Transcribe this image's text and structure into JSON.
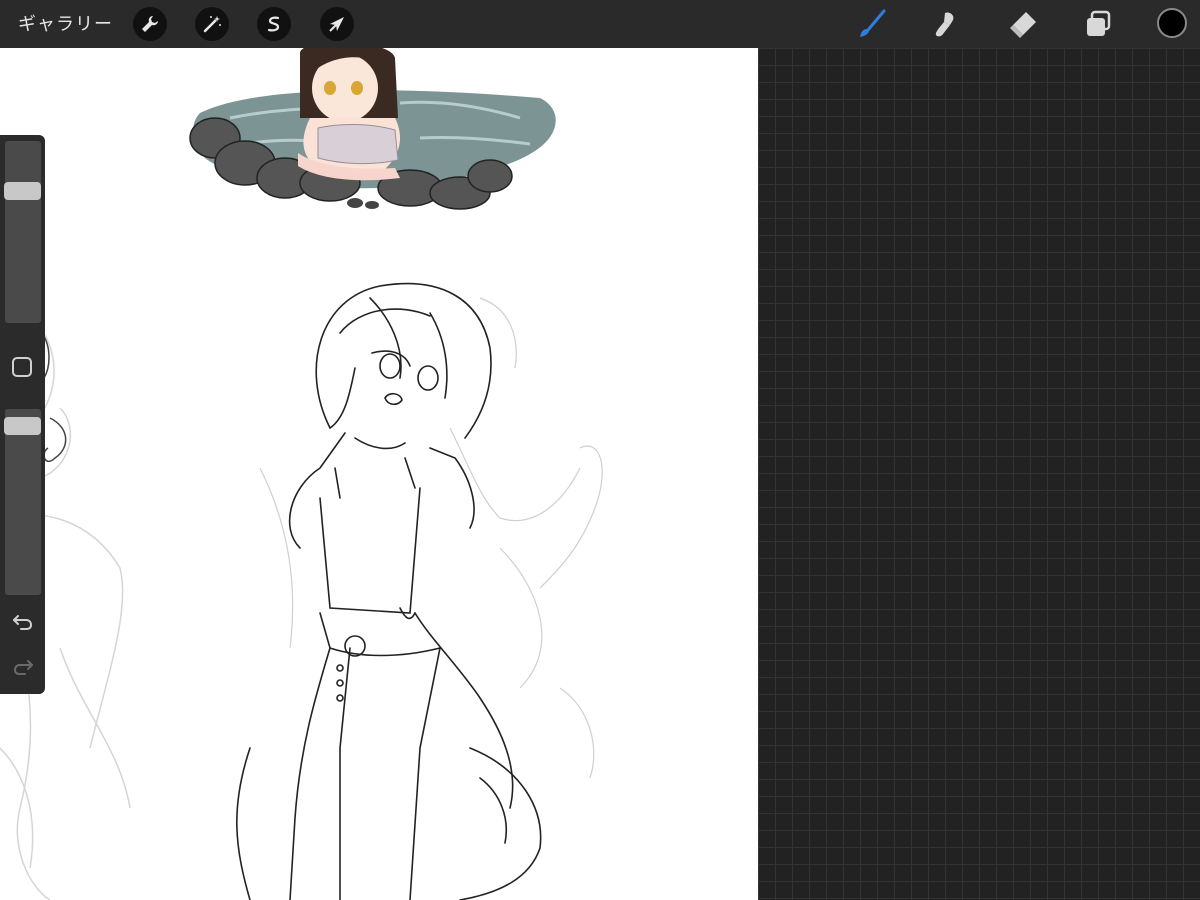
{
  "topbar": {
    "gallery_label": "ギャラリー",
    "left_tools": [
      {
        "icon": "wrench-icon",
        "name": "actions"
      },
      {
        "icon": "magic-wand-icon",
        "name": "adjustments"
      },
      {
        "icon": "selection-s-icon",
        "name": "selection"
      },
      {
        "icon": "arrow-cursor-icon",
        "name": "transform"
      }
    ],
    "right_tools": [
      {
        "icon": "brush-icon",
        "name": "brush",
        "active": true
      },
      {
        "icon": "smudge-icon",
        "name": "smudge",
        "active": false
      },
      {
        "icon": "eraser-icon",
        "name": "eraser",
        "active": false
      },
      {
        "icon": "layers-icon",
        "name": "layers",
        "active": false
      }
    ],
    "current_color": "#000000"
  },
  "sidebar": {
    "brush_size_level": 0.75,
    "opacity_level": 0.95
  },
  "colors": {
    "accent": "#2f7de1",
    "toolbar_bg": "#2a2a2a",
    "canvas_bg": "#ffffff"
  }
}
